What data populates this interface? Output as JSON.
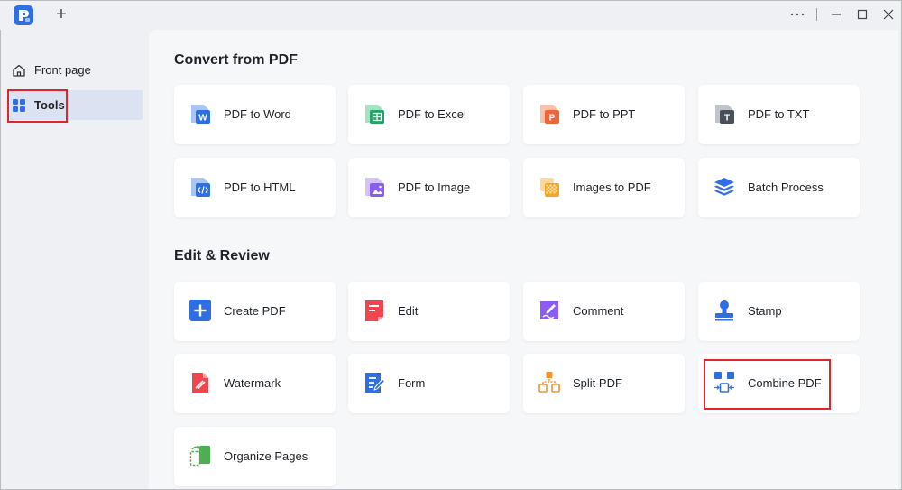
{
  "titlebar": {
    "new_tab": "+"
  },
  "sidebar": {
    "items": [
      {
        "label": "Front page",
        "icon": "home-icon",
        "active": false
      },
      {
        "label": "Tools",
        "icon": "grid-icon",
        "active": true
      }
    ]
  },
  "sections": [
    {
      "title": "Convert from PDF",
      "cards": [
        {
          "label": "PDF to Word",
          "icon": "word-icon",
          "color": "#2f6fe4"
        },
        {
          "label": "PDF to Excel",
          "icon": "excel-icon",
          "color": "#1fa463"
        },
        {
          "label": "PDF to PPT",
          "icon": "ppt-icon",
          "color": "#f0663a"
        },
        {
          "label": "PDF to TXT",
          "icon": "txt-icon",
          "color": "#4a5059"
        },
        {
          "label": "PDF to HTML",
          "icon": "html-icon",
          "color": "#2f6fe4"
        },
        {
          "label": "PDF to Image",
          "icon": "image-icon",
          "color": "#8b5cf6"
        },
        {
          "label": "Images to PDF",
          "icon": "images-to-pdf-icon",
          "color": "#f5a623"
        },
        {
          "label": "Batch Process",
          "icon": "layers-icon",
          "color": "#2f6fe4"
        }
      ]
    },
    {
      "title": "Edit & Review",
      "cards": [
        {
          "label": "Create PDF",
          "icon": "plus-icon",
          "color": "#2f6fe4"
        },
        {
          "label": "Edit",
          "icon": "edit-icon",
          "color": "#f0474f"
        },
        {
          "label": "Comment",
          "icon": "comment-icon",
          "color": "#8b5cf6"
        },
        {
          "label": "Stamp",
          "icon": "stamp-icon",
          "color": "#2f6fe4"
        },
        {
          "label": "Watermark",
          "icon": "watermark-icon",
          "color": "#f0474f"
        },
        {
          "label": "Form",
          "icon": "form-icon",
          "color": "#2f6fe4"
        },
        {
          "label": "Split PDF",
          "icon": "split-icon",
          "color": "#f5942a"
        },
        {
          "label": "Combine PDF",
          "icon": "combine-icon",
          "color": "#2f6fe4"
        },
        {
          "label": "Organize Pages",
          "icon": "organize-icon",
          "color": "#4caf50"
        }
      ]
    }
  ]
}
